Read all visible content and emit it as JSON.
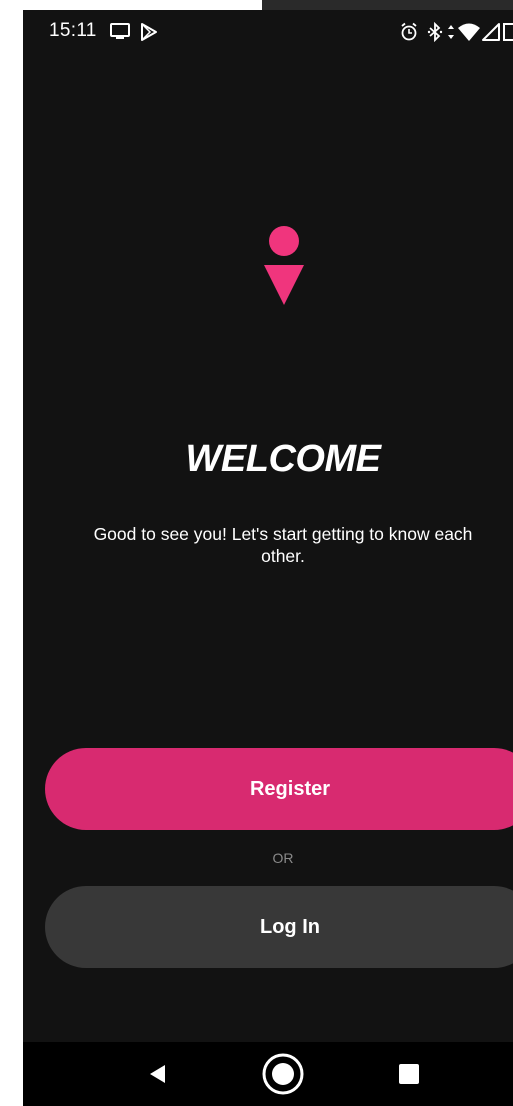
{
  "status_bar": {
    "time": "15:11",
    "icons": [
      "screen-cast-icon",
      "play-store-icon",
      "alarm-icon",
      "bluetooth-icon",
      "data-arrows-icon",
      "wifi-icon",
      "signal-icon",
      "battery-icon"
    ]
  },
  "hero": {
    "logo_icon": "female-figure-logo-icon",
    "title": "WELCOME",
    "subtitle": "Good to see you! Let's start getting to know each other."
  },
  "actions": {
    "register_label": "Register",
    "separator": "OR",
    "login_label": "Log In"
  },
  "nav_bar": {
    "icons": [
      "back-icon",
      "home-icon",
      "recents-icon"
    ]
  },
  "colors": {
    "background": "#121212",
    "accent": "#d82a70",
    "secondary_button": "#383838",
    "muted_text": "#8a8a8a"
  }
}
